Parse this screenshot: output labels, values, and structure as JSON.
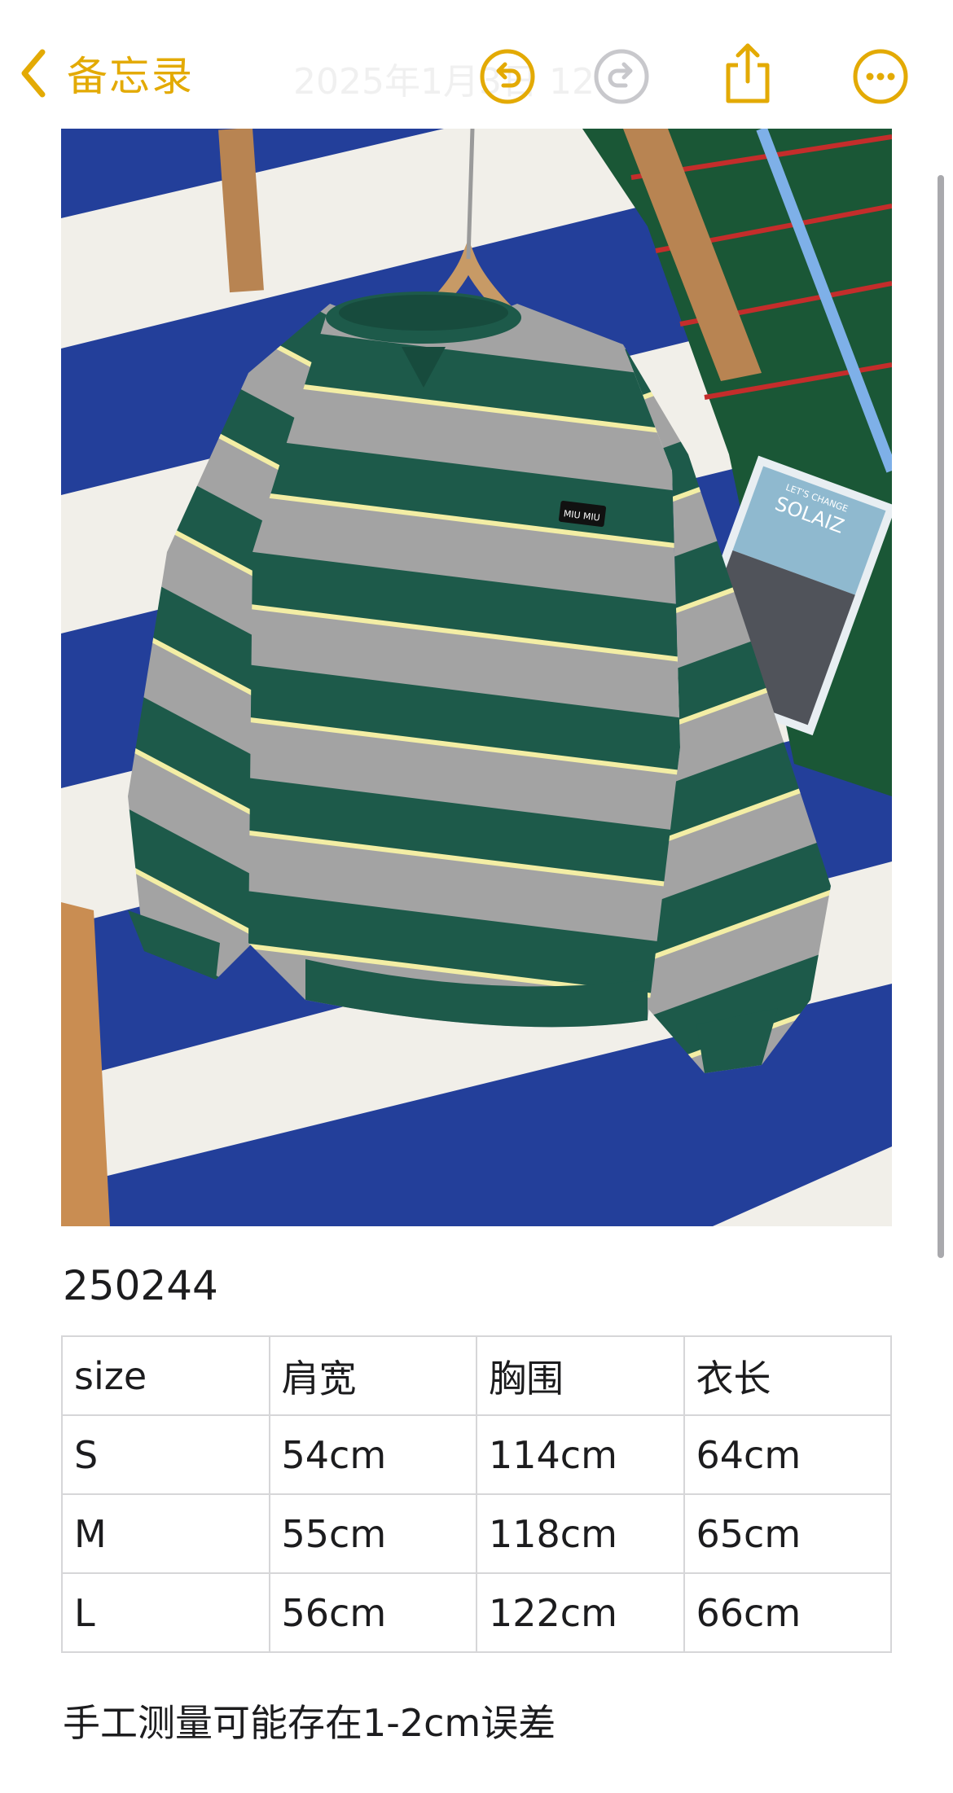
{
  "navbar": {
    "back_label": "备忘录",
    "date": "2025年1月3日 12",
    "accent_color": "#e3aa04",
    "icons": [
      "chevron-left-icon",
      "undo-icon",
      "redo-icon",
      "share-icon",
      "more-icon"
    ]
  },
  "photo": {
    "tag_text": "MIU MIU",
    "magazine_text": "SOLAIZ",
    "magazine_subtext": "LET'S CHANGE"
  },
  "note": {
    "sku": "250244",
    "table": {
      "header": [
        "size",
        "肩宽",
        "胸围",
        "衣长"
      ],
      "rows": [
        [
          "S",
          "54cm",
          "114cm",
          "64cm"
        ],
        [
          "M",
          "55cm",
          "118cm",
          "65cm"
        ],
        [
          "L",
          "56cm",
          "122cm",
          "66cm"
        ]
      ]
    },
    "footer": "手工测量可能存在1-2cm误差"
  }
}
